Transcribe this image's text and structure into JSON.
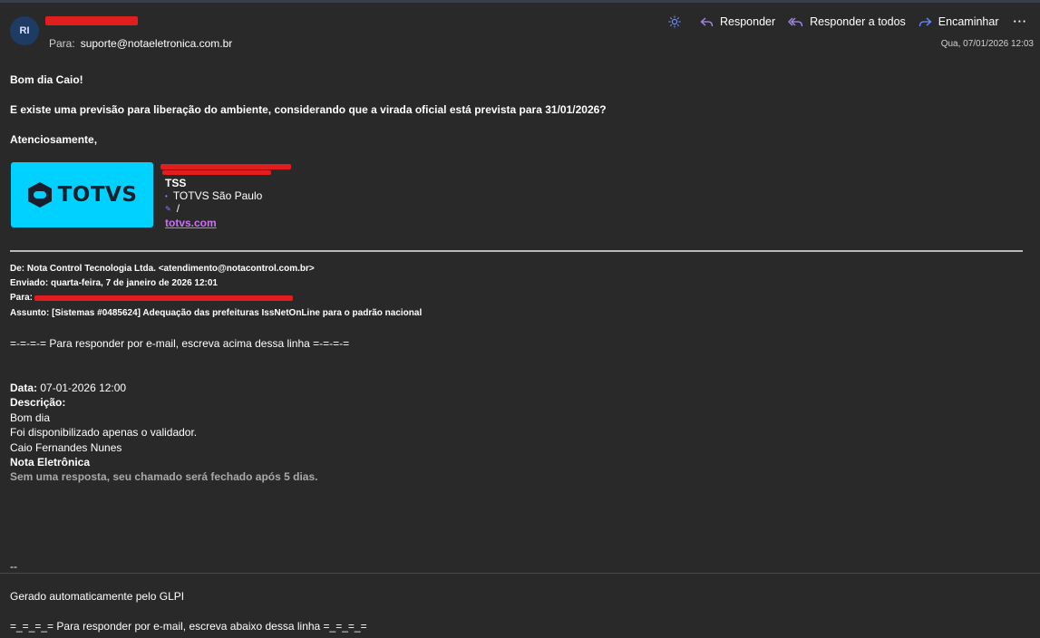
{
  "message": {
    "avatar_initials": "RI",
    "to_label": "Para:",
    "to_address": "suporte@notaeletronica.com.br",
    "date": "Qua, 07/01/2026 12:03"
  },
  "actions": {
    "reply": "Responder",
    "reply_all": "Responder a todos",
    "forward": "Encaminhar",
    "more": "···"
  },
  "body": {
    "greeting": "Bom dia Caio!",
    "question": "E existe uma previsão para liberação do ambiente, considerando que a virada oficial está prevista para 31/01/2026?",
    "closing": "Atenciosamente,"
  },
  "signature": {
    "logo_text": "TOTVS",
    "company": "TSS",
    "location": "TOTVS São Paulo",
    "extra": "/",
    "link": "totvs.com"
  },
  "forwarded": {
    "from_label": "De:",
    "from_value": "Nota Control Tecnologia Ltda. <atendimento@notacontrol.com.br>",
    "sent_label": "Enviado:",
    "sent_value": "quarta-feira, 7 de janeiro de 2026 12:01",
    "to_label": "Para:",
    "subject_label": "Assunto:",
    "subject_value": "[Sistemas #0485624] Adequação das prefeituras IssNetOnLine para o padrão nacional",
    "reply_above": "=-=-=-= Para responder por e-mail, escreva acima dessa linha =-=-=-=",
    "data_label": "Data:",
    "data_value": "07-01-2026 12:00",
    "descricao_label": "Descrição:",
    "lines": [
      "Bom dia",
      "Foi disponibilizado apenas o validador.",
      "Caio Fernandes Nunes"
    ],
    "company_bold": "Nota Eletrônica",
    "warning": "Sem uma resposta, seu chamado será fechado após 5 dias.",
    "sig_sep": "--",
    "generated": "Gerado automaticamente pelo GLPI",
    "reply_below": "=_=_=_= Para responder por e-mail, escreva abaixo dessa linha =_=_=_="
  },
  "colors": {
    "background": "#292929",
    "redaction": "#e01e1e",
    "logo_bg": "#00d1ff",
    "link": "#cf6dff",
    "action_icon": "#6b8cff"
  }
}
